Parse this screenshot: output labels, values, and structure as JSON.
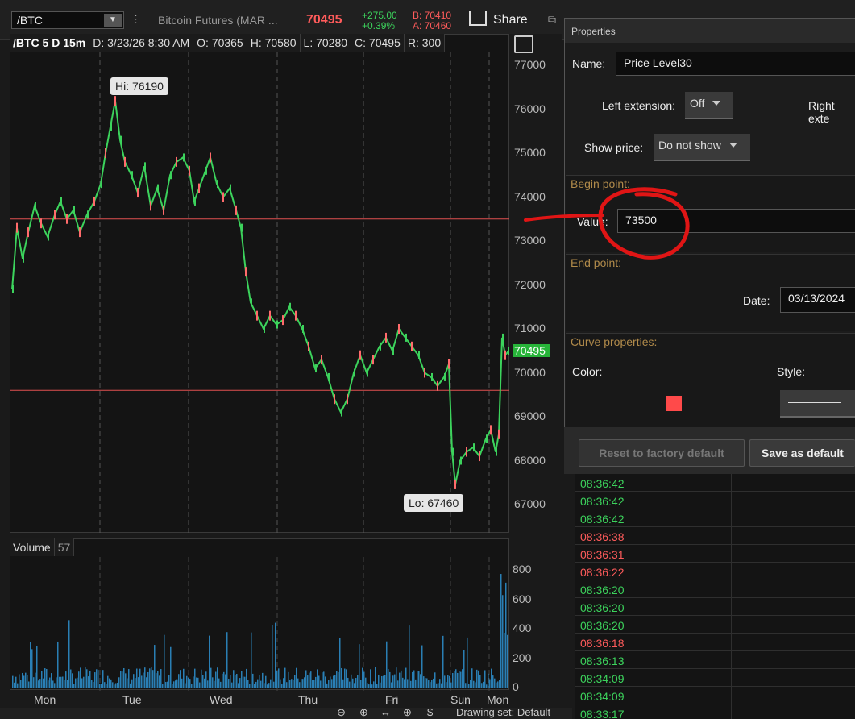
{
  "topbar": {
    "symbol": "/BTC",
    "contract_name": "Bitcoin Futures (MAR ...",
    "last_price": "70495",
    "net_change": "+275.00",
    "net_change_pct": "+0.39%",
    "bid": "B: 70410",
    "ask": "A: 70460",
    "share_label": "Share"
  },
  "chart": {
    "legend": {
      "symbol_period": "/BTC 5 D 15m",
      "date": "D: 3/23/26 8:30 AM",
      "open": "O: 70365",
      "high": "H: 70580",
      "low": "L: 70280",
      "close": "C: 70495",
      "range": "R: 300"
    },
    "hi_callout": "Hi: 76190",
    "lo_callout": "Lo: 67460",
    "current_price_label": "70495",
    "price_ticks": [
      "77000",
      "76000",
      "75000",
      "74000",
      "73000",
      "72000",
      "71000",
      "70000",
      "69000",
      "68000",
      "67000"
    ],
    "price_lines": [
      73500,
      69600
    ],
    "day_labels": [
      "Mon",
      "Tue",
      "Wed",
      "Thu",
      "Fri",
      "Sun",
      "Mon"
    ],
    "volume_label": "Volume",
    "volume_value": "57",
    "volume_ticks": [
      "800",
      "600",
      "400",
      "200",
      "0"
    ],
    "colors": {
      "up": "#3cd35c",
      "down": "#ff6b6b",
      "price_line": "#e05050",
      "volume": "#2a7fb5"
    }
  },
  "bottombar": {
    "drawing_set": "Drawing set: Default"
  },
  "dialog": {
    "title": "Properties",
    "name_label": "Name:",
    "name_value": "Price Level30",
    "left_extension_label": "Left extension:",
    "left_extension_value": "Off",
    "right_extension_label": "Right exte",
    "show_price_label": "Show price:",
    "show_price_value": "Do not show",
    "begin_point_label": "Begin point:",
    "value_label": "Value:",
    "value_value": "73500",
    "end_point_label": "End point:",
    "date_label": "Date:",
    "date_value": "03/13/2024",
    "curve_label": "Curve properties:",
    "color_label": "Color:",
    "color_value": "#ff4a4a",
    "style_label": "Style:",
    "reset_label": "Reset to factory default",
    "save_label": "Save as default"
  },
  "time_sales": [
    {
      "time": "08:36:42",
      "dir": "up"
    },
    {
      "time": "08:36:42",
      "dir": "up"
    },
    {
      "time": "08:36:42",
      "dir": "up"
    },
    {
      "time": "08:36:38",
      "dir": "down"
    },
    {
      "time": "08:36:31",
      "dir": "down"
    },
    {
      "time": "08:36:22",
      "dir": "down"
    },
    {
      "time": "08:36:20",
      "dir": "up"
    },
    {
      "time": "08:36:20",
      "dir": "up"
    },
    {
      "time": "08:36:20",
      "dir": "up"
    },
    {
      "time": "08:36:18",
      "dir": "down"
    },
    {
      "time": "08:36:13",
      "dir": "up"
    },
    {
      "time": "08:34:09",
      "dir": "up"
    },
    {
      "time": "08:34:09",
      "dir": "up"
    },
    {
      "time": "08:33:17",
      "dir": "up"
    }
  ]
}
